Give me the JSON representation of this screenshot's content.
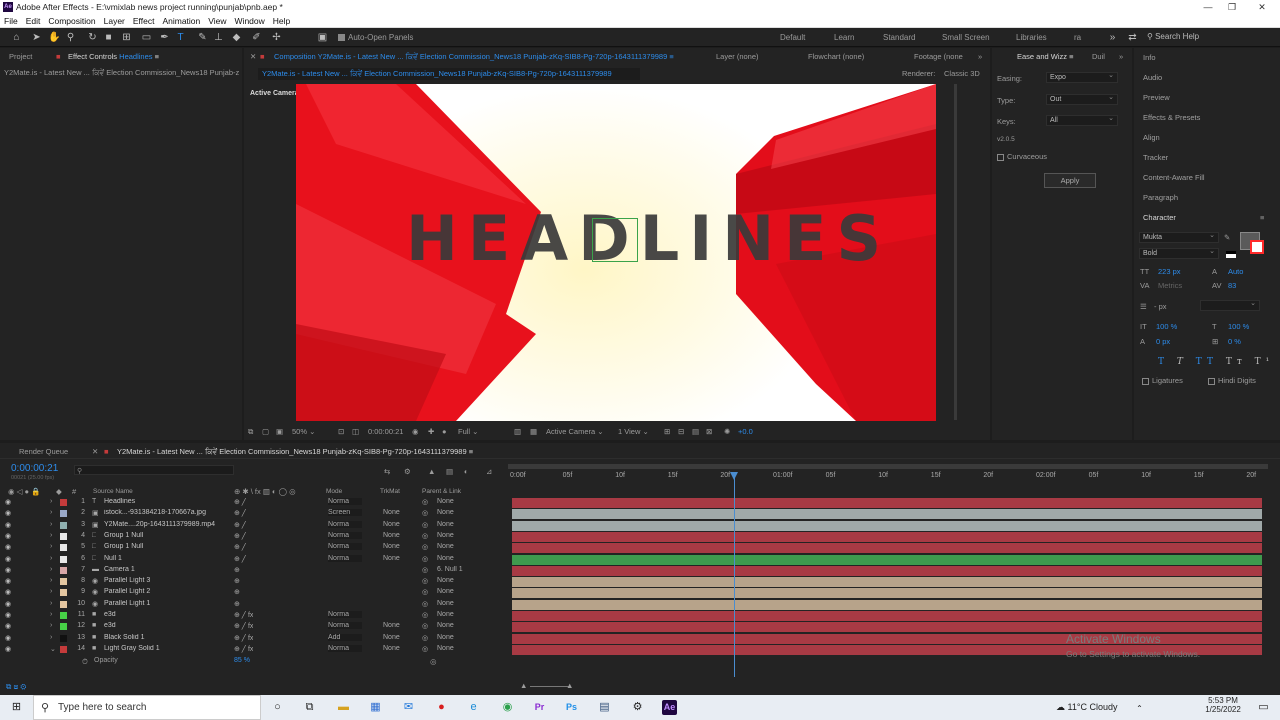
{
  "window": {
    "title": "Adobe After Effects - E:\\vmixlab news project running\\punjab\\pnb.aep *",
    "app_badge": "Ae",
    "min": "—",
    "max": "❐",
    "close": "✕"
  },
  "menu": [
    "File",
    "Edit",
    "Composition",
    "Layer",
    "Effect",
    "Animation",
    "View",
    "Window",
    "Help"
  ],
  "toolbar": {
    "auto_open": "Auto-Open Panels",
    "workspaces": [
      "Default",
      "Learn",
      "Standard",
      "Small Screen",
      "Libraries",
      "ra"
    ],
    "search_help": "Search Help"
  },
  "project_panel": {
    "tab_project": "Project",
    "tab_effect_controls": "Effect Controls",
    "effect_target": "Headlines",
    "subtitle": "Y2Mate.is - Latest New ... ਕਿਵੇਂ Election Commission_News18 Punjab-z"
  },
  "composition_panel": {
    "tab": "Composition Y2Mate.is - Latest New ... ਕਿਵੇਂ Election Commission_News18 Punjab-zKq-SIB8-Pg-720p-1643111379989",
    "other_tabs": [
      "Layer (none)",
      "Flowchart (none)",
      "Footage (none"
    ],
    "sub_tab": "Y2Mate.is - Latest New ... ਕਿਵੇਂ Election Commission_News18 Punjab-zKq-SIB8-Pg-720p-1643111379989",
    "renderer_label": "Renderer:",
    "renderer": "Classic 3D",
    "active_camera": "Active Camera",
    "headline_text": "HEADLINES",
    "zoom": "50%",
    "timecode": "0:00:00:21",
    "resolution": "Full",
    "camera": "Active Camera",
    "views": "1 View",
    "exposure": "+0.0"
  },
  "ease_panel": {
    "tab": "Ease and Wizz",
    "tab2": "Duil",
    "easing_label": "Easing:",
    "easing": "Expo",
    "type_label": "Type:",
    "type": "Out",
    "keys_label": "Keys:",
    "keys": "All",
    "version": "v2.0.5",
    "curvaceous": "Curvaceous",
    "apply": "Apply"
  },
  "right_panel": {
    "items": [
      "Info",
      "Audio",
      "Preview",
      "Effects & Presets",
      "Align",
      "Tracker",
      "Content-Aware Fill",
      "Paragraph"
    ],
    "character_title": "Character",
    "font": "Mukta",
    "style": "Bold",
    "font_size": "223 px",
    "leading": "Auto",
    "kerning": "Metrics",
    "tracking": "83",
    "stroke": "- px",
    "vscale": "100 %",
    "hscale": "100 %",
    "baseline": "0 px",
    "tsume": "0 %",
    "ligatures": "Ligatures",
    "hindi_digits": "Hindi Digits"
  },
  "timeline": {
    "render_queue": "Render Queue",
    "comp_tab": "Y2Mate.is - Latest New ... ਕਿਵੇਂ Election Commission_News18 Punjab-zKq-SIB8-Pg-720p-1643111379989",
    "timecode": "0:00:00:21",
    "timecode_sub": "00021 (25.00 fps)",
    "col_source": "Source Name",
    "col_mode": "Mode",
    "col_trkmat": "TrkMat",
    "col_parent": "Parent & Link",
    "ruler": [
      "0:00f",
      "05f",
      "10f",
      "15f",
      "20f",
      "01:00f",
      "05f",
      "10f",
      "15f",
      "20f",
      "02:00f",
      "05f",
      "10f",
      "15f",
      "20f"
    ],
    "layers": [
      {
        "num": "1",
        "name": "Headlines",
        "mode": "Norma",
        "trk": "",
        "parent": "None",
        "color": "#c43b3b",
        "bar": "#a83a44",
        "type": "T"
      },
      {
        "num": "2",
        "name": "istock...-931384218-170667a.jpg",
        "mode": "Screen",
        "trk": "None",
        "parent": "None",
        "color": "#9aa9c8",
        "bar": "#a0a9a9",
        "type": "img"
      },
      {
        "num": "3",
        "name": "Y2Mate....20p-1643111379989.mp4",
        "mode": "Norma",
        "trk": "None",
        "parent": "None",
        "color": "#8fb0b0",
        "bar": "#a0a9a9",
        "type": "vid"
      },
      {
        "num": "4",
        "name": "Group 1 Null",
        "mode": "Norma",
        "trk": "None",
        "parent": "None",
        "color": "#e8e8e8",
        "bar": "#a83a44",
        "type": "null"
      },
      {
        "num": "5",
        "name": "Group 1 Null",
        "mode": "Norma",
        "trk": "None",
        "parent": "None",
        "color": "#e8e8e8",
        "bar": "#a83a44",
        "type": "null"
      },
      {
        "num": "6",
        "name": "Null 1",
        "mode": "Norma",
        "trk": "None",
        "parent": "None",
        "color": "#e8e8e8",
        "bar": "#3f9a4e",
        "type": "null"
      },
      {
        "num": "7",
        "name": "Camera 1",
        "mode": "",
        "trk": "",
        "parent": "6. Null 1",
        "color": "#d8a7a7",
        "bar": "#a83a44",
        "type": "cam"
      },
      {
        "num": "8",
        "name": "Parallel Light 3",
        "mode": "",
        "trk": "",
        "parent": "None",
        "color": "#e4c6a0",
        "bar": "#b7a38a",
        "type": "light"
      },
      {
        "num": "9",
        "name": "Parallel Light 2",
        "mode": "",
        "trk": "",
        "parent": "None",
        "color": "#e4c6a0",
        "bar": "#b7a38a",
        "type": "light"
      },
      {
        "num": "10",
        "name": "Parallel Light 1",
        "mode": "",
        "trk": "",
        "parent": "None",
        "color": "#e4c6a0",
        "bar": "#b7a38a",
        "type": "light"
      },
      {
        "num": "11",
        "name": "e3d",
        "mode": "Norma",
        "trk": "",
        "parent": "None",
        "color": "#47d147",
        "bar": "#a83a44",
        "type": "solid"
      },
      {
        "num": "12",
        "name": "e3d",
        "mode": "Norma",
        "trk": "None",
        "parent": "None",
        "color": "#47d147",
        "bar": "#a83a44",
        "type": "solid"
      },
      {
        "num": "13",
        "name": "Black Solid 1",
        "mode": "Add",
        "trk": "None",
        "parent": "None",
        "color": "#111111",
        "bar": "#a83a44",
        "type": "solid"
      },
      {
        "num": "14",
        "name": "Light Gray Solid 1",
        "mode": "Norma",
        "trk": "None",
        "parent": "None",
        "color": "#c43b3b",
        "bar": "#a83a44",
        "type": "solid"
      }
    ],
    "opacity_label": "Opacity",
    "opacity_value": "85 %"
  },
  "watermark": {
    "line1": "Activate Windows",
    "line2": "Go to Settings to activate Windows."
  },
  "taskbar": {
    "search": "Type here to search",
    "weather": "11°C  Cloudy",
    "time": "5:53 PM",
    "date": "1/25/2022"
  }
}
